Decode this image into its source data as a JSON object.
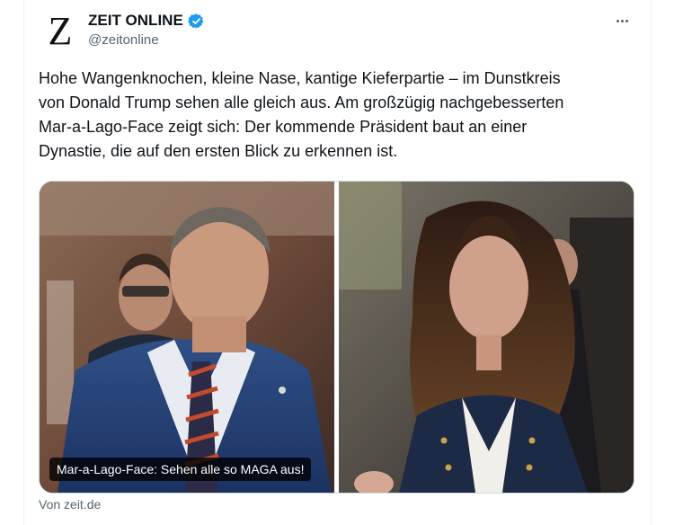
{
  "account": {
    "logo_letter": "Z",
    "name": "ZEIT ONLINE",
    "handle": "@zeitonline"
  },
  "menu": {
    "icon": "more-dots-icon"
  },
  "tweet": {
    "text": "Hohe Wangenknochen, kleine Nase, kantige Kieferpartie – im Dunstkreis\nvon Donald Trump sehen alle gleich aus. Am großzügig nachgebesserten\nMar-a-Lago-Face zeigt sich: Der kommende Präsident baut an einer\nDynastie, die auf den ersten Blick zu erkennen ist."
  },
  "media": {
    "caption": "Mar-a-Lago-Face: Sehen alle so MAGA aus!",
    "source": "Von zeit.de"
  },
  "colors": {
    "verified": "#1d9bf0",
    "muted": "#536471",
    "text": "#0f1419"
  }
}
